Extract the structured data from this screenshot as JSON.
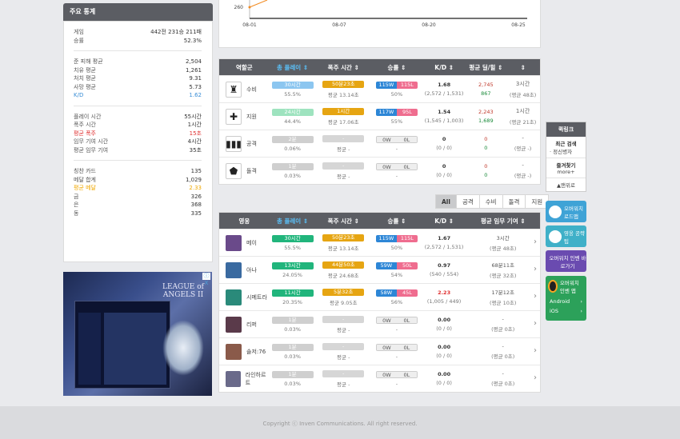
{
  "stats": {
    "title": "주요 통계",
    "groups": [
      [
        {
          "k": "게임",
          "v": "442전 231승 211패"
        },
        {
          "k": "승률",
          "v": "52.3%"
        }
      ],
      [
        {
          "k": "준 피해 평균",
          "v": "2,504"
        },
        {
          "k": "치유 평균",
          "v": "1,261"
        },
        {
          "k": "처치 평균",
          "v": "9.31"
        },
        {
          "k": "사망 평균",
          "v": "5.73"
        },
        {
          "k": "K/D",
          "v": "1.62",
          "c": "blue"
        }
      ],
      [
        {
          "k": "플레이 시간",
          "v": "55시간"
        },
        {
          "k": "폭주 시간",
          "v": "1시간"
        },
        {
          "k": "평균 폭주",
          "v": "15초",
          "c": "red"
        },
        {
          "k": "임무 기여 시간",
          "v": "4시간"
        },
        {
          "k": "평균 임무 기여",
          "v": "35초"
        }
      ],
      [
        {
          "k": "칭찬 카드",
          "v": "135"
        },
        {
          "k": "메달 합계",
          "v": "1,029"
        },
        {
          "k": "평균 메달",
          "v": "2.33",
          "c": "orange"
        },
        {
          "k": "금",
          "v": "326"
        },
        {
          "k": "은",
          "v": "368"
        },
        {
          "k": "동",
          "v": "335"
        }
      ]
    ]
  },
  "chart": {
    "y_tick": "260",
    "x_ticks": [
      "08-01",
      "08-07",
      "08-20",
      "08-25"
    ]
  },
  "role_table": {
    "headers": [
      "역할군",
      "총 플레이 ⇕",
      "폭주 시간 ⇕",
      "승률 ⇕",
      "K/D ⇕",
      "평균 딜/힐 ⇕",
      "⇕"
    ],
    "rows": [
      {
        "icon": "tank-icon",
        "glyph": "♜",
        "name": "수비",
        "play": "30시간",
        "play_pct": "55.5%",
        "play_c": "sky",
        "frenzy": "50분23초",
        "frenzy_sub": "평균 13.14초",
        "frenzy_c": "orange",
        "w": "115W",
        "l": "115L",
        "wr": "50%",
        "kd": "1.68",
        "kd_sub": "(2,572 / 1,531)",
        "dmg": "2,745",
        "heal": "867",
        "avg": "3시간",
        "avg_sub": "(평균 48초)"
      },
      {
        "icon": "support-icon",
        "glyph": "✚",
        "name": "지원",
        "play": "24시간",
        "play_pct": "44.4%",
        "play_c": "mint",
        "frenzy": "1시간",
        "frenzy_sub": "평균 17.06초",
        "frenzy_c": "orange",
        "w": "117W",
        "l": "95L",
        "wr": "55%",
        "kd": "1.54",
        "kd_sub": "(1,545 / 1,003)",
        "dmg": "2,243",
        "heal": "1,689",
        "avg": "1시간",
        "avg_sub": "(평균 21초)"
      },
      {
        "icon": "attack-icon",
        "glyph": "▮▮▮",
        "name": "공격",
        "play": "2분",
        "play_pct": "0.06%",
        "play_c": "gray",
        "frenzy": "-",
        "frenzy_sub": "평균 -",
        "frenzy_c": "lgray",
        "w": "0W",
        "l": "0L",
        "wr": "-",
        "kd": "0",
        "kd_sub": "(0 / 0)",
        "dmg": "0",
        "heal": "0",
        "avg": "-",
        "avg_sub": "(평균 -)",
        "empty": true
      },
      {
        "icon": "defense-icon",
        "glyph": "⬟",
        "name": "돌격",
        "play": "1분",
        "play_pct": "0.03%",
        "play_c": "gray",
        "frenzy": "-",
        "frenzy_sub": "평균 -",
        "frenzy_c": "lgray",
        "w": "0W",
        "l": "0L",
        "wr": "-",
        "kd": "0",
        "kd_sub": "(0 / 0)",
        "dmg": "0",
        "heal": "0",
        "avg": "-",
        "avg_sub": "(평균 -)",
        "empty": true
      }
    ]
  },
  "filters": [
    "All",
    "공격",
    "수비",
    "돌격",
    "지원"
  ],
  "hero_table": {
    "headers": [
      "영웅",
      "총 플레이 ⇕",
      "폭주 시간 ⇕",
      "승률 ⇕",
      "K/D ⇕",
      "평균 임무 기여 ⇕"
    ],
    "rows": [
      {
        "color": "#6a4a8a",
        "name": "메이",
        "play": "30시간",
        "play_pct": "55.5%",
        "play_c": "green",
        "frenzy": "50분23초",
        "frenzy_sub": "평균 13.14초",
        "frenzy_c": "orange",
        "w": "115W",
        "l": "115L",
        "wr": "50%",
        "kd": "1.67",
        "kd_sub": "(2,572 / 1,531)",
        "avg": "3시간",
        "avg_sub": "(평균 48초)"
      },
      {
        "color": "#3a6aa0",
        "name": "아나",
        "play": "13시간",
        "play_pct": "24.05%",
        "play_c": "green",
        "frenzy": "44분50초",
        "frenzy_sub": "평균 24.68초",
        "frenzy_c": "orange",
        "w": "59W",
        "l": "50L",
        "wr": "54%",
        "kd": "0.97",
        "kd_sub": "(540 / 554)",
        "avg": "68분11초",
        "avg_sub": "(평균 32초)"
      },
      {
        "color": "#2a8a7a",
        "name": "시메트라",
        "play": "11시간",
        "play_pct": "20.35%",
        "play_c": "green",
        "frenzy": "5분32초",
        "frenzy_sub": "평균 9.05초",
        "frenzy_c": "orange",
        "w": "58W",
        "l": "45L",
        "wr": "56%",
        "kd": "2.23",
        "kd_sub": "(1,005 / 449)",
        "avg": "17분12초",
        "avg_sub": "(평균 10초)",
        "kd_red": true
      },
      {
        "color": "#5a3a4a",
        "name": "리퍼",
        "play": "1분",
        "play_pct": "0.03%",
        "play_c": "gray",
        "frenzy": "-",
        "frenzy_sub": "평균 -",
        "frenzy_c": "lgray",
        "w": "0W",
        "l": "0L",
        "wr": "-",
        "kd": "0.00",
        "kd_sub": "(0 / 0)",
        "avg": "-",
        "avg_sub": "(평균 0초)",
        "empty": true
      },
      {
        "color": "#8a5a4a",
        "name": "솔저:76",
        "play": "1분",
        "play_pct": "0.03%",
        "play_c": "gray",
        "frenzy": "-",
        "frenzy_sub": "평균 -",
        "frenzy_c": "lgray",
        "w": "0W",
        "l": "0L",
        "wr": "-",
        "kd": "0.00",
        "kd_sub": "(0 / 0)",
        "avg": "-",
        "avg_sub": "(평균 0초)",
        "empty": true
      },
      {
        "color": "#6a6a8a",
        "name": "라인하르트",
        "play": "1분",
        "play_pct": "0.03%",
        "play_c": "gray",
        "frenzy": "-",
        "frenzy_sub": "평균 -",
        "frenzy_c": "lgray",
        "w": "0W",
        "l": "0L",
        "wr": "-",
        "kd": "0.00",
        "kd_sub": "(0 / 0)",
        "avg": "-",
        "avg_sub": "(평균 0초)",
        "empty": true
      }
    ]
  },
  "quick": {
    "title": "퀵링크",
    "recent": "최근 검색",
    "recent_item": "· 정신병자",
    "fav": "즐겨찾기",
    "more": "more+",
    "top": "▲맨위로",
    "btn1": "오버워치 로드맵",
    "btn2": "영웅 공략팁",
    "btn3": "오버워치 인벤 바로가기",
    "btn4": "오버워치 인벤 앱",
    "android": "Android",
    "ios": "iOS"
  },
  "ad": {
    "brand": "LEAGUE of ANGELS II",
    "close": "ⓘ X"
  },
  "footer": "Copyright ⓒ Inven Communications. All right reserved."
}
